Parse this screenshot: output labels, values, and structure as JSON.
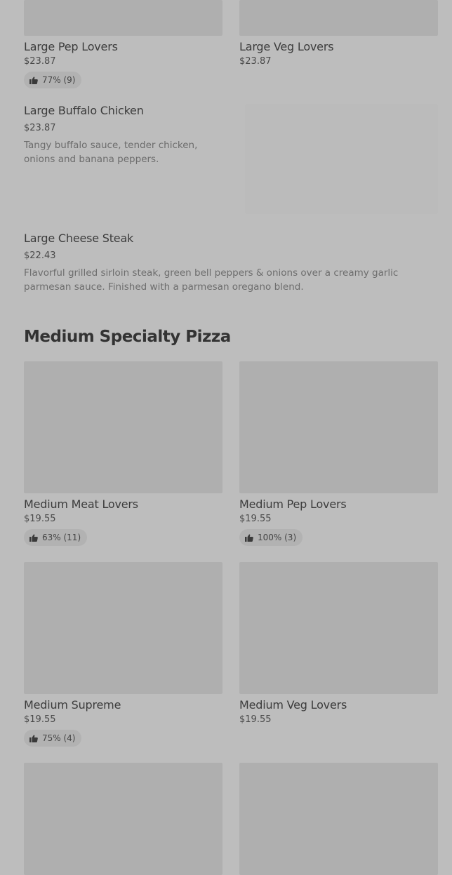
{
  "top_row": [
    {
      "name": "Large Pep Lovers",
      "price": "$23.87",
      "rating": "77% (9)"
    },
    {
      "name": "Large Veg Lovers",
      "price": "$23.87",
      "rating": null
    }
  ],
  "list_items": [
    {
      "name": "Large Buffalo Chicken",
      "price": "$23.87",
      "description": "Tangy buffalo sauce, tender chicken, onions and banana peppers."
    },
    {
      "name": "Large Cheese Steak",
      "price": "$22.43",
      "description": "Flavorful grilled sirloin steak, green bell peppers & onions over a creamy garlic parmesan sauce. Finished with a parmesan oregano blend."
    }
  ],
  "section": {
    "title": "Medium Specialty Pizza"
  },
  "medium_row1": [
    {
      "name": "Medium Meat Lovers",
      "price": "$19.55",
      "rating": "63% (11)"
    },
    {
      "name": "Medium Pep Lovers",
      "price": "$19.55",
      "rating": "100% (3)"
    }
  ],
  "medium_row2": [
    {
      "name": "Medium Supreme",
      "price": "$19.55",
      "rating": "75% (4)"
    },
    {
      "name": "Medium Veg Lovers",
      "price": "$19.55",
      "rating": null
    }
  ],
  "icons": {
    "rating": "thumbs-up-icon"
  },
  "colors": {
    "background": "#bdbdbd",
    "image_placeholder": "#afafaf"
  }
}
